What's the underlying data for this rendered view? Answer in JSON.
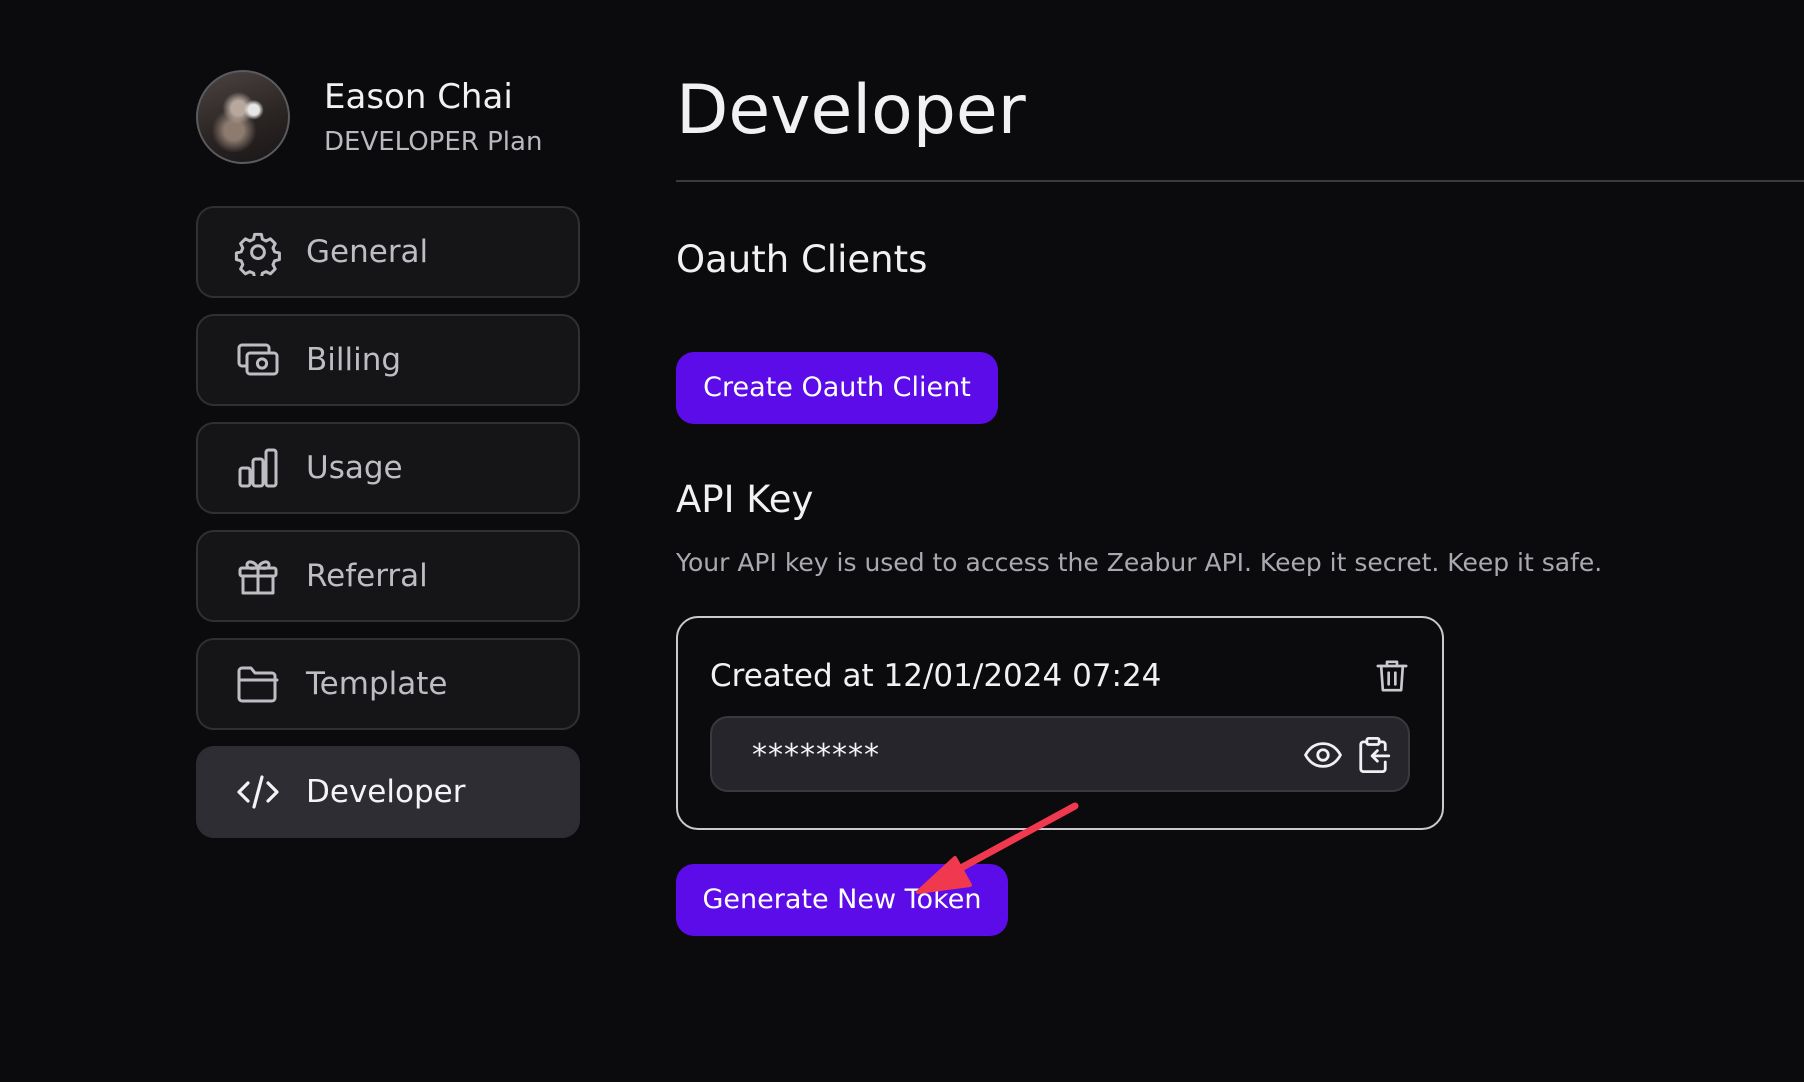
{
  "profile": {
    "name": "Eason Chai",
    "plan": "DEVELOPER Plan"
  },
  "sidebar": {
    "items": [
      {
        "label": "General",
        "icon": "gear-icon"
      },
      {
        "label": "Billing",
        "icon": "billing-icon"
      },
      {
        "label": "Usage",
        "icon": "bar-chart-icon"
      },
      {
        "label": "Referral",
        "icon": "gift-icon"
      },
      {
        "label": "Template",
        "icon": "folder-icon"
      },
      {
        "label": "Developer",
        "icon": "code-icon",
        "active": true
      }
    ]
  },
  "main": {
    "title": "Developer",
    "oauth": {
      "title": "Oauth Clients",
      "button_label": "Create Oauth Client"
    },
    "api_key": {
      "title": "API Key",
      "description": "Your API key is used to access the Zeabur API. Keep it secret. Keep it safe.",
      "created_label": "Created at 12/01/2024 07:24",
      "masked_value": "********",
      "generate_button_label": "Generate New Token"
    }
  },
  "colors": {
    "background": "#0b0b0d",
    "accent": "#5b0ce8",
    "annotation_arrow": "#f0384e"
  }
}
